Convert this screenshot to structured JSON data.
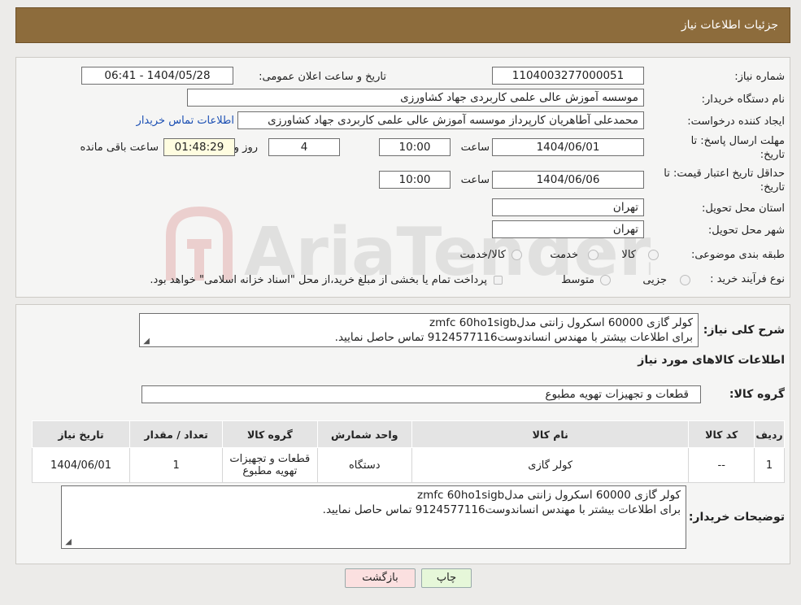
{
  "header": {
    "title": "جزئیات اطلاعات نیاز"
  },
  "form": {
    "need_number_label": "شماره نیاز:",
    "need_number": "1104003277000051",
    "announce_label": "تاریخ و ساعت اعلان عمومی:",
    "announce_value": "1404/05/28 - 06:41",
    "buyer_org_label": "نام دستگاه خریدار:",
    "buyer_org": "موسسه آموزش عالی علمی کاربردی جهاد کشاورزی",
    "requester_label": "ایجاد کننده درخواست:",
    "requester": "محمدعلی آطاهریان کارپرداز موسسه آموزش عالی علمی کاربردی جهاد کشاورزی",
    "contact_link": "اطلاعات تماس خریدار",
    "deadline_label_1": "مهلت ارسال پاسخ: تا",
    "deadline_label_2": "تاریخ:",
    "deadline_date": "1404/06/01",
    "time_label": "ساعت",
    "deadline_time": "10:00",
    "days_value": "4",
    "days_label": "روز و",
    "remaining_time": "01:48:29",
    "remaining_label": "ساعت باقی مانده",
    "validity_label_1": "حداقل تاریخ اعتبار قیمت: تا",
    "validity_label_2": "تاریخ:",
    "validity_date": "1404/06/06",
    "validity_time": "10:00",
    "province_label": "استان محل تحویل:",
    "province": "تهران",
    "city_label": "شهر محل تحویل:",
    "city": "تهران",
    "category_label": "طبقه بندی موضوعی:",
    "category_options": [
      "کالا",
      "خدمت",
      "کالا/خدمت"
    ],
    "purchase_type_label": "نوع فرآیند خرید :",
    "purchase_options": [
      "جزیی",
      "متوسط"
    ],
    "purchase_note": "پرداخت تمام یا بخشی از مبلغ خرید،از محل \"اسناد خزانه اسلامی\" خواهد بود."
  },
  "watermark": "AriaTender.neT",
  "summary": {
    "label": "شرح کلی نیاز:",
    "line1": "کولر گازی 60000 اسکرول زانتی مدلzmfc 60ho1sigb",
    "line2": "برای اطلاعات بیشتر با مهندس انساندوست9124577116 تماس حاصل نمایید."
  },
  "goods_info_title": "اطلاعات کالاهای مورد نیاز",
  "goods_group": {
    "label": "گروه کالا:",
    "value": "قطعات و تجهیزات تهویه مطبوع"
  },
  "table": {
    "headers": [
      "ردیف",
      "کد کالا",
      "نام کالا",
      "واحد شمارش",
      "گروه کالا",
      "تعداد / مقدار",
      "تاریخ نیاز"
    ],
    "rows": [
      {
        "row": "1",
        "code": "--",
        "name": "کولر گازی",
        "unit": "دستگاه",
        "group_line1": "قطعات و تجهیزات",
        "group_line2": "تهویه مطبوع",
        "qty": "1",
        "date": "1404/06/01"
      }
    ]
  },
  "buyer_notes": {
    "label": "توضیحات خریدار:",
    "line1": "کولر گازی 60000 اسکرول زانتی مدلzmfc 60ho1sigb",
    "line2": "برای اطلاعات بیشتر با مهندس انساندوست9124577116 تماس حاصل نمایید."
  },
  "buttons": {
    "print": "چاپ",
    "back": "بازگشت"
  },
  "colors": {
    "header": "#8d6c3c",
    "print_button": "#e6f7d9",
    "back_button": "#fbe0e0",
    "link": "#1b4fb3"
  }
}
